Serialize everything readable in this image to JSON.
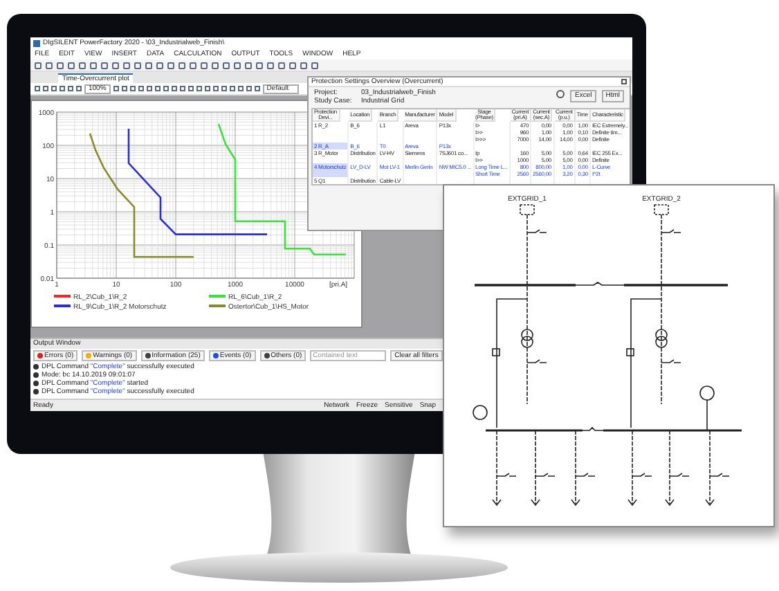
{
  "app": {
    "title": "DIgSILENT PowerFactory 2020 - \\03_Industrialweb_Finish\\",
    "menu": [
      "FILE",
      "EDIT",
      "VIEW",
      "INSERT",
      "DATA",
      "CALCULATION",
      "OUTPUT",
      "TOOLS",
      "WINDOW",
      "HELP"
    ],
    "tabs": [
      {
        "label": "Time-Overcurrent plot",
        "selected": true
      }
    ],
    "zoom": "100%",
    "style": "Default"
  },
  "plot": {
    "y_ticks": [
      "1000",
      "100",
      "10",
      "1",
      "0.1",
      "0.01"
    ],
    "x_ticks": [
      "1",
      "10",
      "100",
      "1000",
      "10000"
    ],
    "x_unit": "[pri.A]",
    "legend": [
      {
        "label": "RL_2\\Cub_1\\R_2",
        "color": "#ff2020"
      },
      {
        "label": "RL_9\\Cub_1\\R_2 Motorschutz",
        "color": "#2a2ae8"
      },
      {
        "label": "RL_6\\Cub_1\\R_2",
        "color": "#33e633"
      },
      {
        "label": "Ostertor\\Cub_1\\HS_Motor",
        "color": "#8a8a2a"
      }
    ]
  },
  "protection": {
    "title": "Protection Settings Overview (Overcurrent)",
    "project_label": "Project:",
    "project": "03_Industrialweb_Finish",
    "study_case_label": "Study Case:",
    "study_case": "Industrial Grid",
    "buttons": [
      "Excel",
      "Html"
    ],
    "columns": [
      "Protection Devi...",
      "Location",
      "Branch",
      "Manufacturer",
      "Model",
      "Stage (Phase)",
      "Current (pri.A)",
      "Current (sec.A)",
      "Current (p.u.)",
      "Time",
      "Characteristic"
    ],
    "rows": [
      {
        "highlighted": false,
        "cells": [
          "1 R_2",
          "B_6",
          "L1",
          "Areva",
          "P13x",
          "I>",
          "470",
          "0,00",
          "0,00",
          "1,00",
          "IEC Extremely..."
        ]
      },
      {
        "highlighted": false,
        "cells": [
          "",
          "",
          "",
          "",
          "",
          "I>>",
          "960",
          "1,00",
          "1,00",
          "0,10",
          "Definite tim..."
        ]
      },
      {
        "highlighted": false,
        "cells": [
          "",
          "",
          "",
          "",
          "",
          "I>>>",
          "7000",
          "14,00",
          "14,00",
          "0,00",
          "Definite"
        ]
      },
      {
        "highlighted": true,
        "cells": [
          "2 R_A",
          "B_6",
          "T0",
          "Areva",
          "P13x",
          "",
          "",
          "",
          "",
          "",
          ""
        ]
      },
      {
        "highlighted": false,
        "cells": [
          "3 R_Motor",
          "Distribution",
          "LV-HV",
          "Siemens",
          "7SJ601 co...",
          "Ip",
          "160",
          "5,00",
          "5,00",
          "0,64",
          "IEC 255 Ex..."
        ]
      },
      {
        "highlighted": false,
        "cells": [
          "",
          "",
          "",
          "",
          "",
          "I>>",
          "1000",
          "5,00",
          "5,00",
          "0,00",
          "Definite"
        ]
      },
      {
        "highlighted": true,
        "cells": [
          "4 Motorschutz",
          "LV_D-LV",
          "Mot LV-1",
          "Merlin Gerin",
          "NW MIC5.0 ...",
          "Long Time L...",
          "800",
          "800,00",
          "1,00",
          "0,00",
          "L-Curve"
        ]
      },
      {
        "highlighted": true,
        "cells": [
          "",
          "",
          "",
          "",
          "",
          "Short Time",
          "2560",
          "2560,00",
          "3,20",
          "0,30",
          "I^2t"
        ]
      },
      {
        "highlighted": false,
        "cells": [
          "5 Q1",
          "Distribution",
          "Cable-LV",
          "",
          "",
          "",
          "",
          "",
          "",
          "",
          ""
        ]
      }
    ]
  },
  "output": {
    "title": "Output Window",
    "filters": [
      {
        "label": "Errors (0)",
        "color": "#e02020"
      },
      {
        "label": "Warnings (0)",
        "color": "#f0b000"
      },
      {
        "label": "Information (25)",
        "color": "#404040"
      },
      {
        "label": "Events (0)",
        "color": "#2050e0"
      },
      {
        "label": "Others (0)",
        "color": "#404040"
      }
    ],
    "filter_placeholder": "Contained text",
    "clear": "Clear all filters",
    "messages": [
      {
        "before": "DPL Command ",
        "quoted": "\"Complete\"",
        "after": " successfully executed"
      },
      {
        "before": "Mode: bc 14.10.2019 09:01:07"
      },
      {
        "before": "DPL Command ",
        "quoted": "\"Complete\"",
        "after": " started"
      },
      {
        "before": "DPL Command ",
        "quoted": "\"Complete\"",
        "after": " successfully executed"
      }
    ]
  },
  "status_bar": [
    "Ready",
    "Network",
    "Freeze",
    "Sensitive",
    "Snap"
  ],
  "diagram": {
    "sources": [
      "EXTGRID_1",
      "EXTGRID_2"
    ]
  }
}
